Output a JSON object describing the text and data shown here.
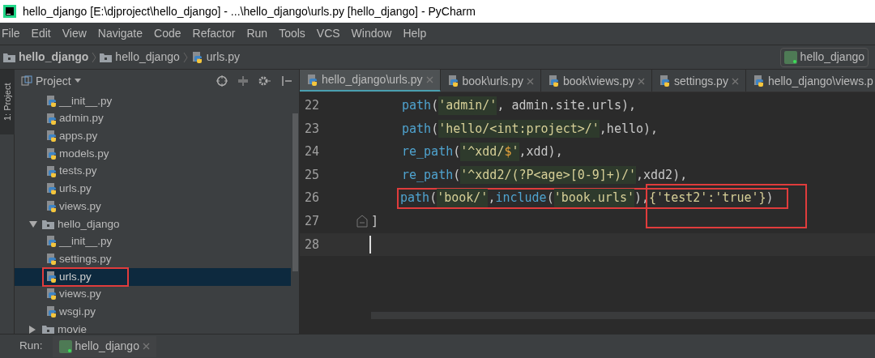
{
  "window": {
    "title": "hello_django [E:\\djproject\\hello_django] - ...\\hello_django\\urls.py [hello_django] - PyCharm"
  },
  "menu": [
    "File",
    "Edit",
    "View",
    "Navigate",
    "Code",
    "Refactor",
    "Run",
    "Tools",
    "VCS",
    "Window",
    "Help"
  ],
  "breadcrumb": [
    {
      "label": "hello_django",
      "kind": "root"
    },
    {
      "label": "hello_django",
      "kind": "folder"
    },
    {
      "label": "urls.py",
      "kind": "file"
    }
  ],
  "run_config": "hello_django",
  "side_stripe": "1: Project",
  "project_panel": {
    "title": "Project",
    "tree": [
      {
        "kind": "continued",
        "children": [
          {
            "kind": "file",
            "label": "__init__.py",
            "selected": false,
            "outlined": false
          },
          {
            "kind": "file",
            "label": "admin.py",
            "selected": false,
            "outlined": false
          },
          {
            "kind": "file",
            "label": "apps.py",
            "selected": false,
            "outlined": false
          },
          {
            "kind": "file",
            "label": "models.py",
            "selected": false,
            "outlined": false
          },
          {
            "kind": "file",
            "label": "tests.py",
            "selected": false,
            "outlined": false
          },
          {
            "kind": "file",
            "label": "urls.py",
            "selected": false,
            "outlined": false
          },
          {
            "kind": "file",
            "label": "views.py",
            "selected": false,
            "outlined": false
          }
        ]
      },
      {
        "kind": "folder",
        "label": "hello_django",
        "expanded": true,
        "children": [
          {
            "kind": "file",
            "label": "__init__.py",
            "selected": false,
            "outlined": false
          },
          {
            "kind": "file",
            "label": "settings.py",
            "selected": false,
            "outlined": false
          },
          {
            "kind": "file",
            "label": "urls.py",
            "selected": true,
            "outlined": true
          },
          {
            "kind": "file",
            "label": "views.py",
            "selected": false,
            "outlined": false
          },
          {
            "kind": "file",
            "label": "wsgi.py",
            "selected": false,
            "outlined": false
          }
        ]
      },
      {
        "kind": "folder",
        "label": "movie",
        "expanded": false
      }
    ]
  },
  "tabs": [
    {
      "label": "hello_django\\urls.py",
      "selected": true
    },
    {
      "label": "book\\urls.py",
      "selected": false
    },
    {
      "label": "book\\views.py",
      "selected": false
    },
    {
      "label": "settings.py",
      "selected": false
    },
    {
      "label": "hello_django\\views.p",
      "selected": false
    }
  ],
  "editor": {
    "lines": [
      {
        "number": "22",
        "current": false,
        "fold": false,
        "tokens": [
          {
            "kind": "func",
            "text": "path"
          },
          {
            "kind": "plain",
            "text": "("
          },
          {
            "kind": "string",
            "text": "'admin/'"
          },
          {
            "kind": "plain",
            "text": ", admin.site.urls),"
          }
        ]
      },
      {
        "number": "23",
        "current": false,
        "fold": false,
        "tokens": [
          {
            "kind": "func",
            "text": "path"
          },
          {
            "kind": "plain",
            "text": "("
          },
          {
            "kind": "string",
            "text": "'hello/<int:project>/'"
          },
          {
            "kind": "plain",
            "text": ",hello),"
          }
        ]
      },
      {
        "number": "24",
        "current": false,
        "fold": false,
        "tokens": [
          {
            "kind": "func",
            "text": "re_path"
          },
          {
            "kind": "plain",
            "text": "("
          },
          {
            "kind": "string",
            "text": "'^xdd/"
          },
          {
            "kind": "regex",
            "text": "$"
          },
          {
            "kind": "string",
            "text": "'"
          },
          {
            "kind": "plain",
            "text": ",xdd),"
          }
        ]
      },
      {
        "number": "25",
        "current": false,
        "fold": false,
        "tokens": [
          {
            "kind": "func",
            "text": "re_path"
          },
          {
            "kind": "plain",
            "text": "("
          },
          {
            "kind": "string",
            "text": "'^xdd2/(?P<age>[0-9]+)/'"
          },
          {
            "kind": "plain",
            "text": ",xdd2),"
          }
        ]
      },
      {
        "number": "26",
        "current": false,
        "outlined": true,
        "fold": false,
        "tokens": [
          {
            "kind": "func",
            "text": "path"
          },
          {
            "kind": "plain",
            "text": "("
          },
          {
            "kind": "string",
            "text": "'book/'"
          },
          {
            "kind": "plain",
            "text": ","
          },
          {
            "kind": "func",
            "text": "include"
          },
          {
            "kind": "plain",
            "text": "("
          },
          {
            "kind": "string",
            "text": "'book.urls'"
          },
          {
            "kind": "plain",
            "text": "),"
          },
          {
            "kind": "boxed",
            "text": "{'test2':'true'}"
          },
          {
            "kind": "plain",
            "text": ")"
          }
        ]
      },
      {
        "number": "27",
        "current": false,
        "fold": true,
        "tokens": [
          {
            "kind": "plain",
            "text": "]"
          }
        ]
      },
      {
        "number": "28",
        "current": true,
        "fold": false
      }
    ]
  },
  "run_bar": {
    "label": "Run:",
    "tab": "hello_django"
  }
}
